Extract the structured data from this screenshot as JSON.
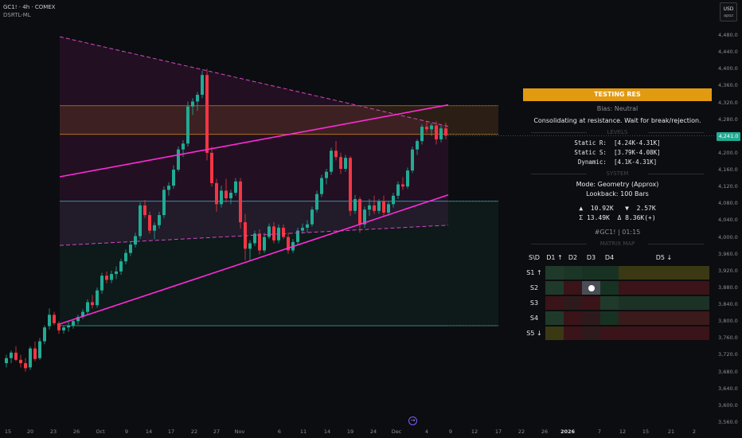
{
  "legend": {
    "symbol_line": "GC1! · 4h · COMEX",
    "indicator": "DSRTL-ML"
  },
  "currency": {
    "code": "USD",
    "sub": "apoz"
  },
  "colors": {
    "background": "#0c0d10",
    "up": "#22ab94",
    "down": "#f23645",
    "magenta": "#ff2bd6",
    "magenta_dashed": "#d447c2",
    "orange_line": "#c07a1c",
    "blue_line": "#3aa0c0",
    "teal_line": "#2fb89d",
    "header_orange": "#e29a11"
  },
  "price_axis": {
    "labels": [
      "4,480.0",
      "4,440.0",
      "4,400.0",
      "4,360.0",
      "4,320.0",
      "4,280.0",
      "4,200.0",
      "4,160.0",
      "4,120.0",
      "4,080.0",
      "4,040.0",
      "4,000.0",
      "3,960.0",
      "3,920.0",
      "3,880.0",
      "3,840.0",
      "3,800.0",
      "3,760.0",
      "3,720.0",
      "3,680.0",
      "3,640.0",
      "3,600.0",
      "3,560.0"
    ],
    "current_price": "4,241.0"
  },
  "time_axis": {
    "labels": [
      "15",
      "20",
      "23",
      "26",
      "Oct",
      "9",
      "14",
      "17",
      "22",
      "27",
      "Nov",
      "6",
      "11",
      "14",
      "19",
      "24",
      "Dec",
      "4",
      "9",
      "12",
      "17",
      "22",
      "26",
      "2026",
      "7",
      "12",
      "15",
      "21",
      "2"
    ],
    "bold_label": "2026"
  },
  "chart_data": {
    "type": "candlestick",
    "instrument": "GC1!",
    "timeframe": "4h",
    "exchange": "COMEX",
    "ylim": [
      3540,
      4500
    ],
    "levels": {
      "orange_top": 4312,
      "orange_bottom": 4244,
      "blue": 4085,
      "teal_bottom": 3789
    },
    "channel": {
      "upper": [
        [
          75,
          4143
        ],
        [
          563,
          4314
        ]
      ],
      "lower": [
        [
          75,
          3793
        ],
        [
          563,
          4100
        ]
      ]
    },
    "wedge": {
      "upper": [
        [
          75,
          4476
        ],
        [
          563,
          4263
        ]
      ],
      "lower": [
        [
          75,
          3980
        ],
        [
          563,
          4028
        ]
      ]
    },
    "candles": [
      [
        8,
        3700,
        3720,
        3690,
        3712
      ],
      [
        14,
        3712,
        3730,
        3700,
        3725
      ],
      [
        20,
        3725,
        3740,
        3705,
        3708
      ],
      [
        26,
        3708,
        3720,
        3690,
        3700
      ],
      [
        32,
        3700,
        3712,
        3680,
        3688
      ],
      [
        38,
        3690,
        3740,
        3684,
        3735
      ],
      [
        44,
        3735,
        3752,
        3705,
        3710
      ],
      [
        50,
        3712,
        3760,
        3708,
        3752
      ],
      [
        56,
        3752,
        3790,
        3745,
        3785
      ],
      [
        62,
        3788,
        3830,
        3780,
        3815
      ],
      [
        68,
        3815,
        3822,
        3790,
        3795
      ],
      [
        74,
        3795,
        3800,
        3770,
        3778
      ],
      [
        80,
        3778,
        3790,
        3770,
        3785
      ],
      [
        86,
        3785,
        3800,
        3775,
        3790
      ],
      [
        92,
        3790,
        3805,
        3782,
        3800
      ],
      [
        98,
        3800,
        3815,
        3792,
        3810
      ],
      [
        104,
        3810,
        3828,
        3805,
        3822
      ],
      [
        110,
        3822,
        3852,
        3815,
        3845
      ],
      [
        116,
        3845,
        3862,
        3830,
        3838
      ],
      [
        122,
        3838,
        3880,
        3832,
        3873
      ],
      [
        128,
        3873,
        3915,
        3865,
        3908
      ],
      [
        134,
        3908,
        3918,
        3890,
        3898
      ],
      [
        140,
        3898,
        3920,
        3890,
        3912
      ],
      [
        146,
        3912,
        3930,
        3900,
        3918
      ],
      [
        152,
        3918,
        3948,
        3910,
        3942
      ],
      [
        158,
        3942,
        3970,
        3935,
        3962
      ],
      [
        164,
        3962,
        3990,
        3955,
        3982
      ],
      [
        170,
        3982,
        4010,
        3975,
        4002
      ],
      [
        176,
        4002,
        4082,
        3995,
        4075
      ],
      [
        182,
        4075,
        4088,
        4045,
        4052
      ],
      [
        188,
        4052,
        4060,
        4008,
        4015
      ],
      [
        194,
        4015,
        4035,
        3995,
        4028
      ],
      [
        200,
        4028,
        4060,
        4020,
        4052
      ],
      [
        206,
        4052,
        4120,
        4045,
        4112
      ],
      [
        212,
        4112,
        4130,
        4098,
        4122
      ],
      [
        218,
        4122,
        4170,
        4115,
        4160
      ],
      [
        224,
        4160,
        4215,
        4155,
        4208
      ],
      [
        230,
        4208,
        4230,
        4190,
        4222
      ],
      [
        236,
        4222,
        4322,
        4215,
        4310
      ],
      [
        242,
        4310,
        4330,
        4290,
        4322
      ],
      [
        248,
        4322,
        4345,
        4300,
        4338
      ],
      [
        254,
        4338,
        4395,
        4330,
        4385
      ],
      [
        260,
        4385,
        4400,
        4182,
        4200
      ],
      [
        266,
        4200,
        4215,
        4120,
        4128
      ],
      [
        272,
        4128,
        4138,
        4060,
        4078
      ],
      [
        278,
        4078,
        4122,
        4070,
        4110
      ],
      [
        284,
        4110,
        4138,
        4082,
        4092
      ],
      [
        290,
        4092,
        4112,
        4078,
        4105
      ],
      [
        296,
        4105,
        4140,
        4098,
        4132
      ],
      [
        302,
        4132,
        4140,
        4020,
        4035
      ],
      [
        308,
        4035,
        4055,
        3945,
        3972
      ],
      [
        314,
        3972,
        3992,
        3945,
        3985
      ],
      [
        320,
        3985,
        4015,
        3978,
        4008
      ],
      [
        326,
        4008,
        4018,
        3958,
        3968
      ],
      [
        332,
        3968,
        4010,
        3962,
        4000
      ],
      [
        338,
        4000,
        4032,
        3995,
        4025
      ],
      [
        344,
        4025,
        4035,
        3985,
        3992
      ],
      [
        350,
        3992,
        4030,
        3985,
        4022
      ],
      [
        356,
        4022,
        4030,
        3995,
        4000
      ],
      [
        362,
        4000,
        4010,
        3960,
        3968
      ],
      [
        368,
        3968,
        3995,
        3962,
        3988
      ],
      [
        374,
        3988,
        4022,
        3982,
        4015
      ],
      [
        380,
        4015,
        4032,
        4008,
        4022
      ],
      [
        386,
        4022,
        4040,
        4010,
        4030
      ],
      [
        392,
        4030,
        4072,
        4025,
        4065
      ],
      [
        398,
        4065,
        4110,
        4058,
        4102
      ],
      [
        404,
        4102,
        4148,
        4095,
        4140
      ],
      [
        410,
        4140,
        4162,
        4125,
        4155
      ],
      [
        416,
        4155,
        4212,
        4148,
        4205
      ],
      [
        422,
        4205,
        4228,
        4182,
        4190
      ],
      [
        428,
        4190,
        4200,
        4150,
        4162
      ],
      [
        434,
        4162,
        4195,
        4155,
        4188
      ],
      [
        440,
        4188,
        4192,
        4050,
        4062
      ],
      [
        446,
        4062,
        4100,
        4055,
        4090
      ],
      [
        452,
        4090,
        4095,
        4010,
        4030
      ],
      [
        458,
        4030,
        4072,
        4022,
        4065
      ],
      [
        464,
        4065,
        4090,
        4050,
        4075
      ],
      [
        470,
        4075,
        4098,
        4055,
        4062
      ],
      [
        476,
        4062,
        4090,
        4055,
        4085
      ],
      [
        482,
        4085,
        4098,
        4050,
        4058
      ],
      [
        488,
        4058,
        4085,
        4050,
        4078
      ],
      [
        494,
        4078,
        4105,
        4070,
        4098
      ],
      [
        500,
        4098,
        4132,
        4090,
        4125
      ],
      [
        506,
        4125,
        4142,
        4112,
        4120
      ],
      [
        512,
        4120,
        4165,
        4115,
        4158
      ],
      [
        518,
        4158,
        4215,
        4152,
        4208
      ],
      [
        524,
        4208,
        4232,
        4195,
        4228
      ],
      [
        530,
        4228,
        4268,
        4220,
        4262
      ],
      [
        536,
        4262,
        4275,
        4248,
        4256
      ],
      [
        542,
        4256,
        4270,
        4240,
        4265
      ],
      [
        548,
        4265,
        4275,
        4220,
        4232
      ],
      [
        554,
        4232,
        4265,
        4225,
        4258
      ],
      [
        560,
        4258,
        4272,
        4232,
        4241
      ]
    ]
  },
  "panel": {
    "status": "TESTING RES",
    "bias": "Bias: Neutral",
    "message": "Consolidating at resistance. Wait for break/rejection.",
    "levels_title": "LEVELS",
    "static_r": "Static R:  [4.24K-4.31K]",
    "static_s": "Static S:  [3.79K-4.08K]",
    "dynamic": "Dynamic:  [4.1K-4.31K]",
    "system_title": "SYSTEM",
    "mode": "Mode: Geometry (Approx)",
    "lookback": "Lookback: 100 Bars",
    "stats1": "▲  10.92K   ▼  2.57K",
    "stats2": "Σ 13.49K  Δ 8.36K(+)",
    "ticker_time": "#GC1! | 01:15",
    "matrix_title": "MATRIX MAP",
    "matrix": {
      "corner": "S\\D",
      "cols": [
        "D1 ↑",
        "D2",
        "D3",
        "D4",
        "D5 ↓"
      ],
      "rows": [
        "S1 ↑",
        "S2",
        "S3",
        "S4",
        "S5 ↓"
      ]
    }
  }
}
